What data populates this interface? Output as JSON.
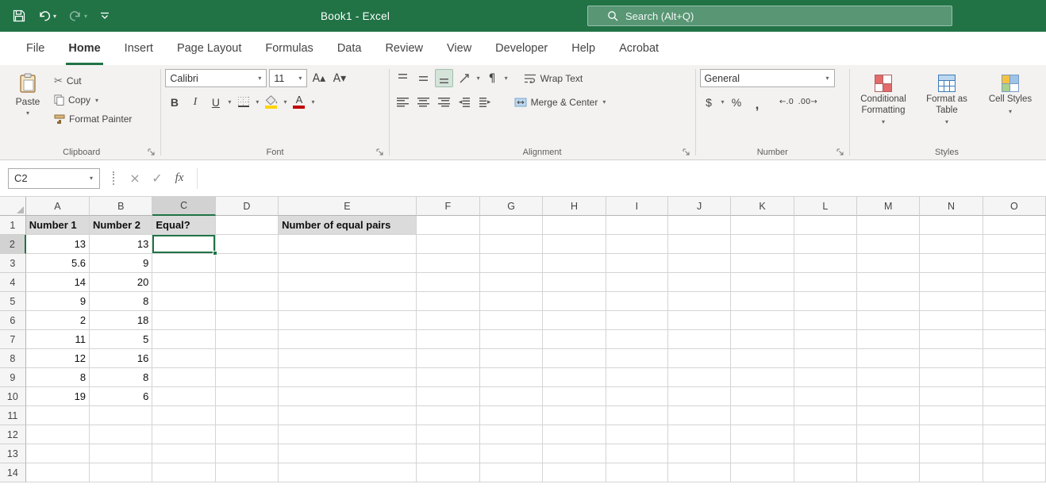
{
  "colors": {
    "excel_green": "#217346",
    "row1_fill": "#DBDBDB",
    "font_color_red": "#C00000",
    "fill_color_yellow": "#FFD400"
  },
  "titlebar": {
    "title": "Book1 - Excel",
    "search_placeholder": "Search (Alt+Q)"
  },
  "ribbon_tabs": [
    "File",
    "Home",
    "Insert",
    "Page Layout",
    "Formulas",
    "Data",
    "Review",
    "View",
    "Developer",
    "Help",
    "Acrobat"
  ],
  "active_tab": "Home",
  "ribbon": {
    "clipboard": {
      "group_label": "Clipboard",
      "paste": "Paste",
      "cut": "Cut",
      "copy": "Copy",
      "format_painter": "Format Painter"
    },
    "font": {
      "group_label": "Font",
      "family": "Calibri",
      "size": "11",
      "bold": "B",
      "italic": "I",
      "underline": "U",
      "font_color_letter": "A",
      "grow_font": "A▴",
      "shrink_font": "A▾"
    },
    "alignment": {
      "group_label": "Alignment",
      "wrap_text": "Wrap Text",
      "merge_center": "Merge & Center"
    },
    "number": {
      "group_label": "Number",
      "format": "General",
      "currency": "$",
      "percent": "%",
      "comma": ",",
      "increase_decimal": "←.0",
      "decrease_decimal": ".00→"
    },
    "styles": {
      "group_label": "Styles",
      "conditional_formatting": "Conditional Formatting",
      "format_as_table": "Format as Table",
      "cell_styles": "Cell Styles"
    }
  },
  "formula_bar": {
    "name_box": "C2",
    "fx": "fx",
    "formula": ""
  },
  "icons": {
    "dropdown": "▾",
    "scissors": "✂",
    "check": "✓",
    "cancel": "×",
    "paragraph": "¶"
  },
  "grid": {
    "columns": [
      "A",
      "B",
      "C",
      "D",
      "E",
      "F",
      "G",
      "H",
      "I",
      "J",
      "K",
      "L",
      "M",
      "N",
      "O"
    ],
    "row_count": 14,
    "selected_column": "C",
    "selected_row": 2,
    "active_cell": "C2",
    "cells": {
      "A1": "Number 1",
      "B1": "Number 2",
      "C1": "Equal?",
      "E1": "Number of equal pairs",
      "A2": "13",
      "B2": "13",
      "A3": "5.6",
      "B3": "9",
      "A4": "14",
      "B4": "20",
      "A5": "9",
      "B5": "8",
      "A6": "2",
      "B6": "18",
      "A7": "11",
      "B7": "5",
      "A8": "12",
      "B8": "16",
      "A9": "8",
      "B9": "8",
      "A10": "19",
      "B10": "6"
    }
  }
}
